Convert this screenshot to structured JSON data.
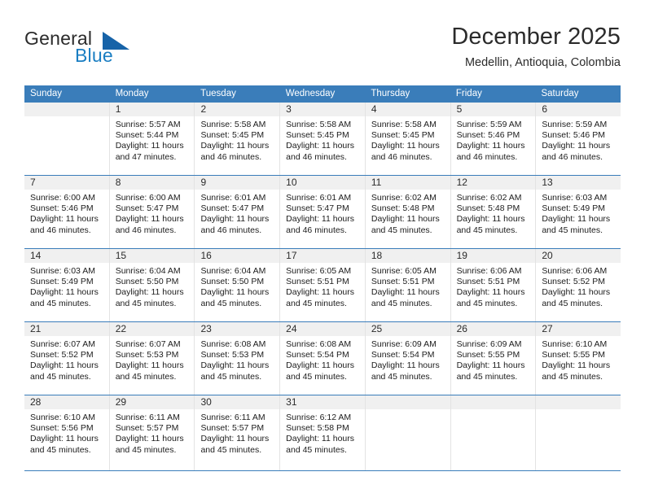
{
  "logo": {
    "word1": "General",
    "word2": "Blue",
    "triangle_color": "#1763a8",
    "blue_color": "#1a7ec2"
  },
  "header": {
    "title": "December 2025",
    "subtitle": "Medellin, Antioquia, Colombia",
    "header_bg": "#3a7dba",
    "band_bg": "#f0f0f0"
  },
  "weekdays": [
    "Sunday",
    "Monday",
    "Tuesday",
    "Wednesday",
    "Thursday",
    "Friday",
    "Saturday"
  ],
  "weeks": [
    [
      {
        "day": "",
        "empty": true
      },
      {
        "day": "1",
        "sunrise": "Sunrise: 5:57 AM",
        "sunset": "Sunset: 5:44 PM",
        "daylight1": "Daylight: 11 hours",
        "daylight2": "and 47 minutes."
      },
      {
        "day": "2",
        "sunrise": "Sunrise: 5:58 AM",
        "sunset": "Sunset: 5:45 PM",
        "daylight1": "Daylight: 11 hours",
        "daylight2": "and 46 minutes."
      },
      {
        "day": "3",
        "sunrise": "Sunrise: 5:58 AM",
        "sunset": "Sunset: 5:45 PM",
        "daylight1": "Daylight: 11 hours",
        "daylight2": "and 46 minutes."
      },
      {
        "day": "4",
        "sunrise": "Sunrise: 5:58 AM",
        "sunset": "Sunset: 5:45 PM",
        "daylight1": "Daylight: 11 hours",
        "daylight2": "and 46 minutes."
      },
      {
        "day": "5",
        "sunrise": "Sunrise: 5:59 AM",
        "sunset": "Sunset: 5:46 PM",
        "daylight1": "Daylight: 11 hours",
        "daylight2": "and 46 minutes."
      },
      {
        "day": "6",
        "sunrise": "Sunrise: 5:59 AM",
        "sunset": "Sunset: 5:46 PM",
        "daylight1": "Daylight: 11 hours",
        "daylight2": "and 46 minutes."
      }
    ],
    [
      {
        "day": "7",
        "sunrise": "Sunrise: 6:00 AM",
        "sunset": "Sunset: 5:46 PM",
        "daylight1": "Daylight: 11 hours",
        "daylight2": "and 46 minutes."
      },
      {
        "day": "8",
        "sunrise": "Sunrise: 6:00 AM",
        "sunset": "Sunset: 5:47 PM",
        "daylight1": "Daylight: 11 hours",
        "daylight2": "and 46 minutes."
      },
      {
        "day": "9",
        "sunrise": "Sunrise: 6:01 AM",
        "sunset": "Sunset: 5:47 PM",
        "daylight1": "Daylight: 11 hours",
        "daylight2": "and 46 minutes."
      },
      {
        "day": "10",
        "sunrise": "Sunrise: 6:01 AM",
        "sunset": "Sunset: 5:47 PM",
        "daylight1": "Daylight: 11 hours",
        "daylight2": "and 46 minutes."
      },
      {
        "day": "11",
        "sunrise": "Sunrise: 6:02 AM",
        "sunset": "Sunset: 5:48 PM",
        "daylight1": "Daylight: 11 hours",
        "daylight2": "and 45 minutes."
      },
      {
        "day": "12",
        "sunrise": "Sunrise: 6:02 AM",
        "sunset": "Sunset: 5:48 PM",
        "daylight1": "Daylight: 11 hours",
        "daylight2": "and 45 minutes."
      },
      {
        "day": "13",
        "sunrise": "Sunrise: 6:03 AM",
        "sunset": "Sunset: 5:49 PM",
        "daylight1": "Daylight: 11 hours",
        "daylight2": "and 45 minutes."
      }
    ],
    [
      {
        "day": "14",
        "sunrise": "Sunrise: 6:03 AM",
        "sunset": "Sunset: 5:49 PM",
        "daylight1": "Daylight: 11 hours",
        "daylight2": "and 45 minutes."
      },
      {
        "day": "15",
        "sunrise": "Sunrise: 6:04 AM",
        "sunset": "Sunset: 5:50 PM",
        "daylight1": "Daylight: 11 hours",
        "daylight2": "and 45 minutes."
      },
      {
        "day": "16",
        "sunrise": "Sunrise: 6:04 AM",
        "sunset": "Sunset: 5:50 PM",
        "daylight1": "Daylight: 11 hours",
        "daylight2": "and 45 minutes."
      },
      {
        "day": "17",
        "sunrise": "Sunrise: 6:05 AM",
        "sunset": "Sunset: 5:51 PM",
        "daylight1": "Daylight: 11 hours",
        "daylight2": "and 45 minutes."
      },
      {
        "day": "18",
        "sunrise": "Sunrise: 6:05 AM",
        "sunset": "Sunset: 5:51 PM",
        "daylight1": "Daylight: 11 hours",
        "daylight2": "and 45 minutes."
      },
      {
        "day": "19",
        "sunrise": "Sunrise: 6:06 AM",
        "sunset": "Sunset: 5:51 PM",
        "daylight1": "Daylight: 11 hours",
        "daylight2": "and 45 minutes."
      },
      {
        "day": "20",
        "sunrise": "Sunrise: 6:06 AM",
        "sunset": "Sunset: 5:52 PM",
        "daylight1": "Daylight: 11 hours",
        "daylight2": "and 45 minutes."
      }
    ],
    [
      {
        "day": "21",
        "sunrise": "Sunrise: 6:07 AM",
        "sunset": "Sunset: 5:52 PM",
        "daylight1": "Daylight: 11 hours",
        "daylight2": "and 45 minutes."
      },
      {
        "day": "22",
        "sunrise": "Sunrise: 6:07 AM",
        "sunset": "Sunset: 5:53 PM",
        "daylight1": "Daylight: 11 hours",
        "daylight2": "and 45 minutes."
      },
      {
        "day": "23",
        "sunrise": "Sunrise: 6:08 AM",
        "sunset": "Sunset: 5:53 PM",
        "daylight1": "Daylight: 11 hours",
        "daylight2": "and 45 minutes."
      },
      {
        "day": "24",
        "sunrise": "Sunrise: 6:08 AM",
        "sunset": "Sunset: 5:54 PM",
        "daylight1": "Daylight: 11 hours",
        "daylight2": "and 45 minutes."
      },
      {
        "day": "25",
        "sunrise": "Sunrise: 6:09 AM",
        "sunset": "Sunset: 5:54 PM",
        "daylight1": "Daylight: 11 hours",
        "daylight2": "and 45 minutes."
      },
      {
        "day": "26",
        "sunrise": "Sunrise: 6:09 AM",
        "sunset": "Sunset: 5:55 PM",
        "daylight1": "Daylight: 11 hours",
        "daylight2": "and 45 minutes."
      },
      {
        "day": "27",
        "sunrise": "Sunrise: 6:10 AM",
        "sunset": "Sunset: 5:55 PM",
        "daylight1": "Daylight: 11 hours",
        "daylight2": "and 45 minutes."
      }
    ],
    [
      {
        "day": "28",
        "sunrise": "Sunrise: 6:10 AM",
        "sunset": "Sunset: 5:56 PM",
        "daylight1": "Daylight: 11 hours",
        "daylight2": "and 45 minutes."
      },
      {
        "day": "29",
        "sunrise": "Sunrise: 6:11 AM",
        "sunset": "Sunset: 5:57 PM",
        "daylight1": "Daylight: 11 hours",
        "daylight2": "and 45 minutes."
      },
      {
        "day": "30",
        "sunrise": "Sunrise: 6:11 AM",
        "sunset": "Sunset: 5:57 PM",
        "daylight1": "Daylight: 11 hours",
        "daylight2": "and 45 minutes."
      },
      {
        "day": "31",
        "sunrise": "Sunrise: 6:12 AM",
        "sunset": "Sunset: 5:58 PM",
        "daylight1": "Daylight: 11 hours",
        "daylight2": "and 45 minutes."
      },
      {
        "day": "",
        "empty": true
      },
      {
        "day": "",
        "empty": true
      },
      {
        "day": "",
        "empty": true
      }
    ]
  ]
}
